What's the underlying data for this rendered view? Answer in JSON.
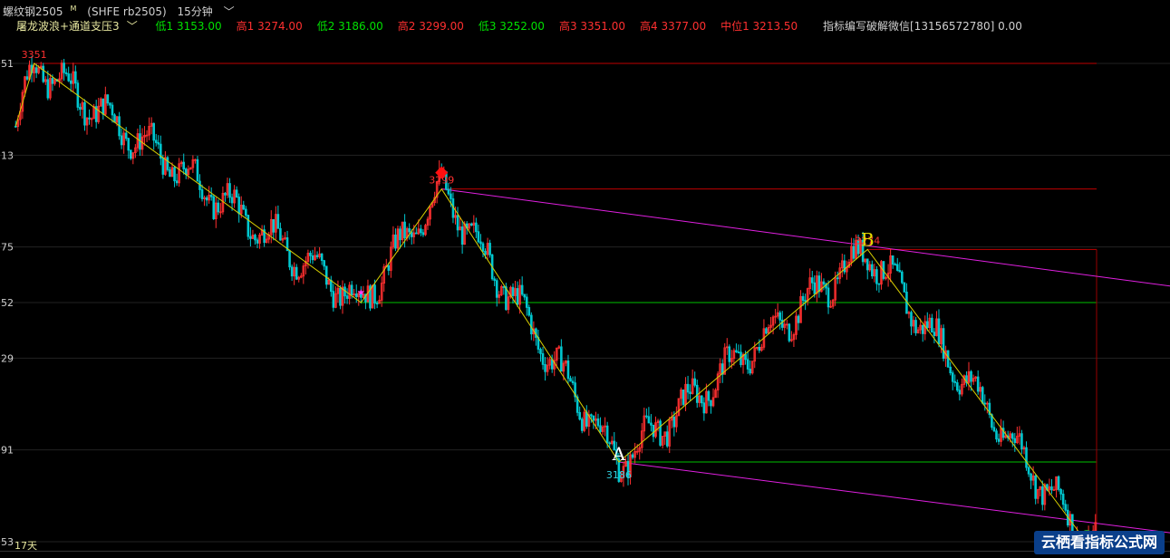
{
  "titlebar": {
    "symbol": "螺纹钢2505",
    "superscript": "M",
    "code": "(SHFE rb2505)",
    "period": "15分钟"
  },
  "legend": {
    "indicator_name": "屠龙波浪+通道支压3",
    "items": [
      {
        "label": "低1",
        "value": "3153.00",
        "kind": "low"
      },
      {
        "label": "高1",
        "value": "3274.00",
        "kind": "high"
      },
      {
        "label": "低2",
        "value": "3186.00",
        "kind": "low"
      },
      {
        "label": "高2",
        "value": "3299.00",
        "kind": "high"
      },
      {
        "label": "低3",
        "value": "3252.00",
        "kind": "low"
      },
      {
        "label": "高3",
        "value": "3351.00",
        "kind": "high"
      },
      {
        "label": "高4",
        "value": "3377.00",
        "kind": "high"
      },
      {
        "label": "中位1",
        "value": "3213.50",
        "kind": "high"
      }
    ],
    "extra": "指标编写破解微信[13156572780] 0.00"
  },
  "days_label": "17天",
  "watermark": "云栖看指标公式网",
  "colors": {
    "up_candle": "#ff3030",
    "down_candle": "#00c8d0",
    "wave_line": "#d8d000",
    "channel_line": "#e020e0",
    "support_line": "#00c000",
    "resistance_line": "#c00000",
    "label_high": "#ff3030",
    "label_low": "#30d0e0"
  },
  "chart_data": {
    "type": "candlestick",
    "ylim": [
      3153,
      3360
    ],
    "ytick_labels": [
      "51",
      "13",
      "75",
      "52",
      "29",
      "91",
      "53"
    ],
    "ytick_values": [
      3351,
      3313,
      3275,
      3252,
      3229,
      3191,
      3153
    ],
    "wave_points": [
      {
        "bar": 0,
        "value": 3325,
        "label": ""
      },
      {
        "bar": 8,
        "value": 3351,
        "label": "3351"
      },
      {
        "bar": 150,
        "value": 3252,
        "label": ""
      },
      {
        "bar": 185,
        "value": 3299,
        "label": "3299"
      },
      {
        "bar": 262,
        "value": 3186,
        "label": "3186"
      },
      {
        "bar": 370,
        "value": 3274,
        "label": "3274"
      },
      {
        "bar": 465,
        "value": 3153,
        "label": ""
      }
    ],
    "wave_letters": [
      {
        "letter": "A",
        "bar": 262,
        "value": 3186
      },
      {
        "letter": "B",
        "bar": 370,
        "value": 3274
      },
      {
        "letter": "C",
        "bar": 465,
        "value": 3153
      }
    ],
    "horizontal_levels": [
      {
        "value": 3351,
        "from_bar": 8,
        "kind": "resistance"
      },
      {
        "value": 3299,
        "from_bar": 185,
        "kind": "resistance"
      },
      {
        "value": 3274,
        "from_bar": 370,
        "kind": "resistance"
      },
      {
        "value": 3252,
        "from_bar": 150,
        "kind": "support"
      },
      {
        "value": 3186,
        "from_bar": 262,
        "kind": "support"
      }
    ],
    "channels": [
      {
        "from_bar": 185,
        "from_value": 3299,
        "to_bar": 500,
        "to_value": 3256
      },
      {
        "from_bar": 262,
        "from_value": 3186,
        "to_bar": 500,
        "to_value": 3154
      }
    ],
    "bar_count": 470
  }
}
